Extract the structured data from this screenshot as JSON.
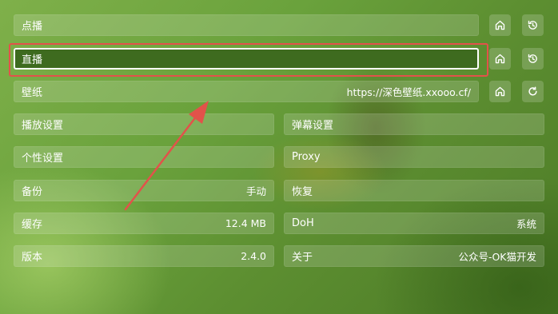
{
  "rows": {
    "vod": {
      "label": "点播"
    },
    "live": {
      "label": "直播"
    },
    "wallpaper": {
      "label": "壁纸",
      "value": "https://深色壁纸.xxooo.cf/"
    }
  },
  "grid_left": [
    {
      "label": "播放设置",
      "value": ""
    },
    {
      "label": "个性设置",
      "value": ""
    },
    {
      "label": "备份",
      "value": "手动"
    },
    {
      "label": "缓存",
      "value": "12.4 MB"
    },
    {
      "label": "版本",
      "value": "2.4.0"
    }
  ],
  "grid_right": [
    {
      "label": "弹幕设置",
      "value": ""
    },
    {
      "label": "Proxy",
      "value": ""
    },
    {
      "label": "恢复",
      "value": ""
    },
    {
      "label": "DoH",
      "value": "系统"
    },
    {
      "label": "关于",
      "value": "公众号-OK猫开发"
    }
  ],
  "icons": {
    "home": "home-icon",
    "history": "history-icon",
    "refresh": "refresh-icon"
  },
  "colors": {
    "highlight_border": "#e2524a",
    "arrow": "#e2524a",
    "focused_row": "#3e6b1f"
  }
}
